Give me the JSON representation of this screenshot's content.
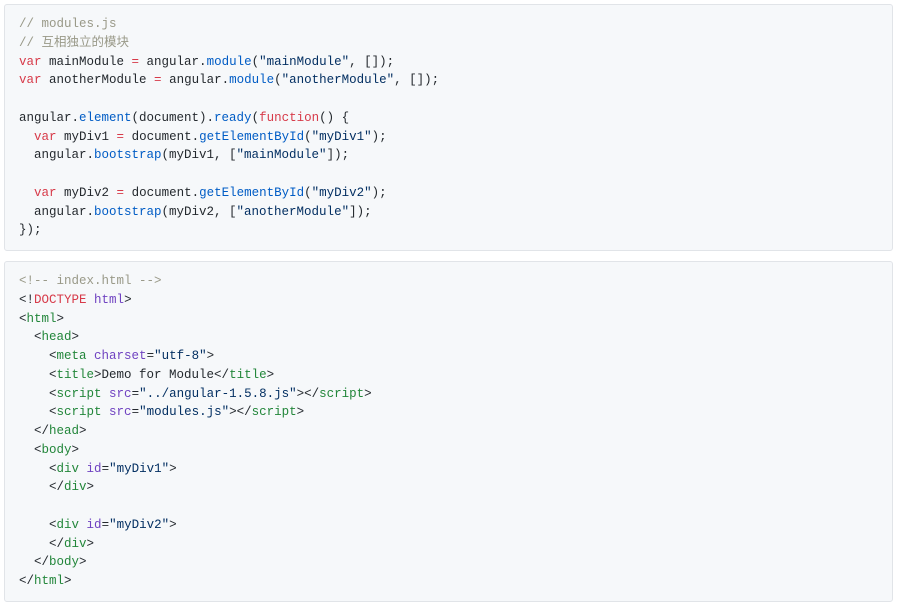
{
  "block1": {
    "lines": [
      [
        {
          "c": "comment",
          "t": "// modules.js"
        }
      ],
      [
        {
          "c": "comment",
          "t": "// 互相独立的模块"
        }
      ],
      [
        {
          "c": "keyword",
          "t": "var"
        },
        {
          "c": "plain",
          "t": " mainModule "
        },
        {
          "c": "keyword",
          "t": "="
        },
        {
          "c": "plain",
          "t": " angular."
        },
        {
          "c": "func",
          "t": "module"
        },
        {
          "c": "plain",
          "t": "("
        },
        {
          "c": "string",
          "t": "\"mainModule\""
        },
        {
          "c": "plain",
          "t": ", []);"
        }
      ],
      [
        {
          "c": "keyword",
          "t": "var"
        },
        {
          "c": "plain",
          "t": " anotherModule "
        },
        {
          "c": "keyword",
          "t": "="
        },
        {
          "c": "plain",
          "t": " angular."
        },
        {
          "c": "func",
          "t": "module"
        },
        {
          "c": "plain",
          "t": "("
        },
        {
          "c": "string",
          "t": "\"anotherModule\""
        },
        {
          "c": "plain",
          "t": ", []);"
        }
      ],
      [
        {
          "c": "plain",
          "t": ""
        }
      ],
      [
        {
          "c": "plain",
          "t": "angular."
        },
        {
          "c": "func",
          "t": "element"
        },
        {
          "c": "plain",
          "t": "(document)."
        },
        {
          "c": "func",
          "t": "ready"
        },
        {
          "c": "plain",
          "t": "("
        },
        {
          "c": "keyword",
          "t": "function"
        },
        {
          "c": "plain",
          "t": "() {"
        }
      ],
      [
        {
          "c": "plain",
          "t": "  "
        },
        {
          "c": "keyword",
          "t": "var"
        },
        {
          "c": "plain",
          "t": " myDiv1 "
        },
        {
          "c": "keyword",
          "t": "="
        },
        {
          "c": "plain",
          "t": " document."
        },
        {
          "c": "func",
          "t": "getElementById"
        },
        {
          "c": "plain",
          "t": "("
        },
        {
          "c": "string",
          "t": "\"myDiv1\""
        },
        {
          "c": "plain",
          "t": ");"
        }
      ],
      [
        {
          "c": "plain",
          "t": "  angular."
        },
        {
          "c": "func",
          "t": "bootstrap"
        },
        {
          "c": "plain",
          "t": "(myDiv1, ["
        },
        {
          "c": "string",
          "t": "\"mainModule\""
        },
        {
          "c": "plain",
          "t": "]);"
        }
      ],
      [
        {
          "c": "plain",
          "t": ""
        }
      ],
      [
        {
          "c": "plain",
          "t": "  "
        },
        {
          "c": "keyword",
          "t": "var"
        },
        {
          "c": "plain",
          "t": " myDiv2 "
        },
        {
          "c": "keyword",
          "t": "="
        },
        {
          "c": "plain",
          "t": " document."
        },
        {
          "c": "func",
          "t": "getElementById"
        },
        {
          "c": "plain",
          "t": "("
        },
        {
          "c": "string",
          "t": "\"myDiv2\""
        },
        {
          "c": "plain",
          "t": ");"
        }
      ],
      [
        {
          "c": "plain",
          "t": "  angular."
        },
        {
          "c": "func",
          "t": "bootstrap"
        },
        {
          "c": "plain",
          "t": "(myDiv2, ["
        },
        {
          "c": "string",
          "t": "\"anotherModule\""
        },
        {
          "c": "plain",
          "t": "]);"
        }
      ],
      [
        {
          "c": "plain",
          "t": "});"
        }
      ]
    ]
  },
  "block2": {
    "lines": [
      [
        {
          "c": "comment",
          "t": "<!-- index.html -->"
        }
      ],
      [
        {
          "c": "plain",
          "t": "<!"
        },
        {
          "c": "keyword",
          "t": "DOCTYPE"
        },
        {
          "c": "plain",
          "t": " "
        },
        {
          "c": "attr",
          "t": "html"
        },
        {
          "c": "plain",
          "t": ">"
        }
      ],
      [
        {
          "c": "plain",
          "t": "<"
        },
        {
          "c": "tag",
          "t": "html"
        },
        {
          "c": "plain",
          "t": ">"
        }
      ],
      [
        {
          "c": "plain",
          "t": "  <"
        },
        {
          "c": "tag",
          "t": "head"
        },
        {
          "c": "plain",
          "t": ">"
        }
      ],
      [
        {
          "c": "plain",
          "t": "    <"
        },
        {
          "c": "tag",
          "t": "meta"
        },
        {
          "c": "plain",
          "t": " "
        },
        {
          "c": "attr",
          "t": "charset"
        },
        {
          "c": "plain",
          "t": "="
        },
        {
          "c": "string",
          "t": "\"utf-8\""
        },
        {
          "c": "plain",
          "t": ">"
        }
      ],
      [
        {
          "c": "plain",
          "t": "    <"
        },
        {
          "c": "tag",
          "t": "title"
        },
        {
          "c": "plain",
          "t": ">Demo for Module</"
        },
        {
          "c": "tag",
          "t": "title"
        },
        {
          "c": "plain",
          "t": ">"
        }
      ],
      [
        {
          "c": "plain",
          "t": "    <"
        },
        {
          "c": "tag",
          "t": "script"
        },
        {
          "c": "plain",
          "t": " "
        },
        {
          "c": "attr",
          "t": "src"
        },
        {
          "c": "plain",
          "t": "="
        },
        {
          "c": "string",
          "t": "\"../angular-1.5.8.js\""
        },
        {
          "c": "plain",
          "t": "></"
        },
        {
          "c": "tag",
          "t": "script"
        },
        {
          "c": "plain",
          "t": ">"
        }
      ],
      [
        {
          "c": "plain",
          "t": "    <"
        },
        {
          "c": "tag",
          "t": "script"
        },
        {
          "c": "plain",
          "t": " "
        },
        {
          "c": "attr",
          "t": "src"
        },
        {
          "c": "plain",
          "t": "="
        },
        {
          "c": "string",
          "t": "\"modules.js\""
        },
        {
          "c": "plain",
          "t": "></"
        },
        {
          "c": "tag",
          "t": "script"
        },
        {
          "c": "plain",
          "t": ">"
        }
      ],
      [
        {
          "c": "plain",
          "t": "  </"
        },
        {
          "c": "tag",
          "t": "head"
        },
        {
          "c": "plain",
          "t": ">"
        }
      ],
      [
        {
          "c": "plain",
          "t": "  <"
        },
        {
          "c": "tag",
          "t": "body"
        },
        {
          "c": "plain",
          "t": ">"
        }
      ],
      [
        {
          "c": "plain",
          "t": "    <"
        },
        {
          "c": "tag",
          "t": "div"
        },
        {
          "c": "plain",
          "t": " "
        },
        {
          "c": "attr",
          "t": "id"
        },
        {
          "c": "plain",
          "t": "="
        },
        {
          "c": "string",
          "t": "\"myDiv1\""
        },
        {
          "c": "plain",
          "t": ">"
        }
      ],
      [
        {
          "c": "plain",
          "t": "    </"
        },
        {
          "c": "tag",
          "t": "div"
        },
        {
          "c": "plain",
          "t": ">"
        }
      ],
      [
        {
          "c": "plain",
          "t": ""
        }
      ],
      [
        {
          "c": "plain",
          "t": "    <"
        },
        {
          "c": "tag",
          "t": "div"
        },
        {
          "c": "plain",
          "t": " "
        },
        {
          "c": "attr",
          "t": "id"
        },
        {
          "c": "plain",
          "t": "="
        },
        {
          "c": "string",
          "t": "\"myDiv2\""
        },
        {
          "c": "plain",
          "t": ">"
        }
      ],
      [
        {
          "c": "plain",
          "t": "    </"
        },
        {
          "c": "tag",
          "t": "div"
        },
        {
          "c": "plain",
          "t": ">"
        }
      ],
      [
        {
          "c": "plain",
          "t": "  </"
        },
        {
          "c": "tag",
          "t": "body"
        },
        {
          "c": "plain",
          "t": ">"
        }
      ],
      [
        {
          "c": "plain",
          "t": "</"
        },
        {
          "c": "tag",
          "t": "html"
        },
        {
          "c": "plain",
          "t": ">"
        }
      ]
    ]
  }
}
